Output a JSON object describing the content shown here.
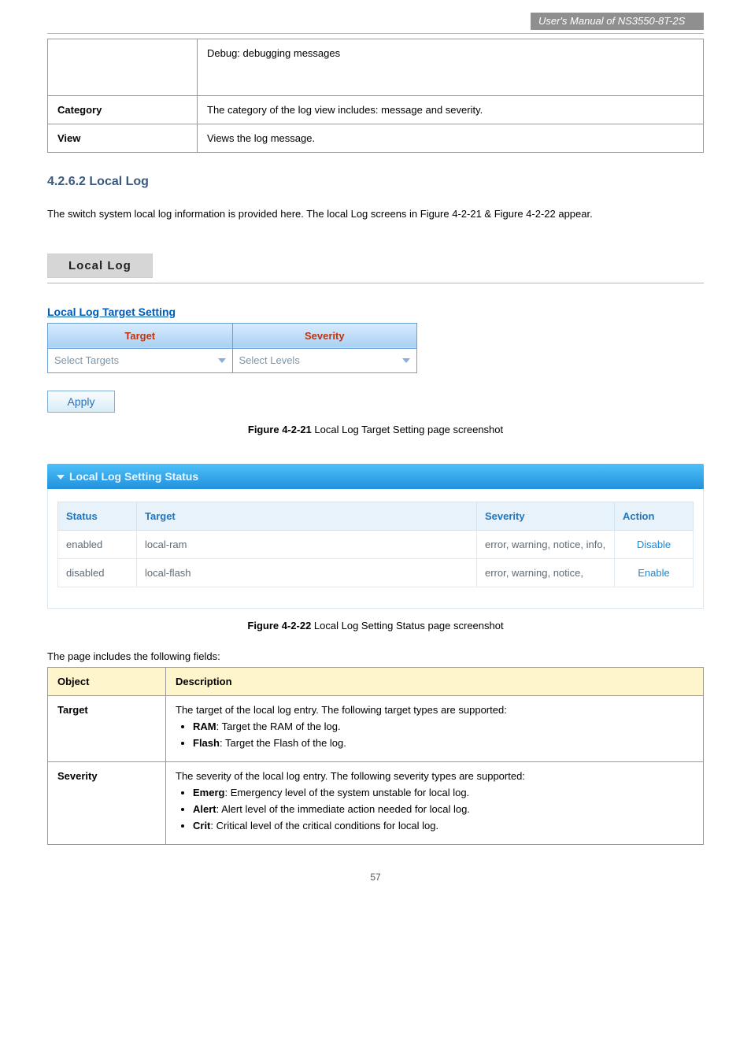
{
  "header": {
    "manual_title": "User's Manual of NS3550-8T-2S"
  },
  "obj_table": {
    "rows": [
      {
        "label": "",
        "desc": "Debug: debugging messages",
        "tall": true
      },
      {
        "label": "Category",
        "desc": "The category of the log view includes: message and severity."
      },
      {
        "label": "View",
        "desc": "Views the log message."
      }
    ]
  },
  "subsection": {
    "number": "4.2.6.2",
    "title": "Local Log",
    "intro": "The switch system local log information is provided here. The local Log screens in Figure 4-2-21 & Figure 4-2-22 appear."
  },
  "tab": {
    "label": "Local Log"
  },
  "figure1": {
    "title": "Local Log Target Setting",
    "headers": [
      "Target",
      "Severity"
    ],
    "placeholders": [
      "Select Targets",
      "Select Levels"
    ],
    "apply": "Apply",
    "caption_strong": "Figure 4-2-21",
    "caption_rest": " Local Log Target Setting page screenshot"
  },
  "figure2": {
    "header": "Local Log Setting Status",
    "cols": [
      "Status",
      "Target",
      "Severity",
      "Action"
    ],
    "rows": [
      {
        "status": "enabled",
        "target": "local-ram",
        "severity": "error, warning, notice, info,",
        "action": "Disable"
      },
      {
        "status": "disabled",
        "target": "local-flash",
        "severity": "error, warning, notice,",
        "action": "Enable"
      }
    ],
    "caption_strong": "Figure 4-2-22",
    "caption_rest": " Local Log Setting Status page screenshot"
  },
  "desc": {
    "intro": "The page includes the following fields:",
    "headers": [
      "Object",
      "Description"
    ],
    "rows": [
      {
        "object": "Target",
        "lead": "The target of the local log entry. The following target types are supported:",
        "items": [
          {
            "b": "RAM",
            "t": ": Target the RAM of the log."
          },
          {
            "b": "Flash",
            "t": ": Target the Flash of the log."
          }
        ]
      },
      {
        "object": "Severity",
        "lead": "The severity of the local log entry. The following severity types are supported:",
        "items": [
          {
            "b": "Emerg",
            "t": ": Emergency level of the system unstable for local log."
          },
          {
            "b": "Alert",
            "t": ": Alert level of the immediate action needed for local log."
          },
          {
            "b": "Crit",
            "t": ": Critical level of the critical conditions for local log."
          }
        ]
      }
    ]
  },
  "footer": {
    "page": "57"
  },
  "chart_data": {
    "type": "table",
    "title": "Local Log Setting Status",
    "columns": [
      "Status",
      "Target",
      "Severity",
      "Action"
    ],
    "rows": [
      [
        "enabled",
        "local-ram",
        "error, warning, notice, info,",
        "Disable"
      ],
      [
        "disabled",
        "local-flash",
        "error, warning, notice,",
        "Enable"
      ]
    ]
  }
}
